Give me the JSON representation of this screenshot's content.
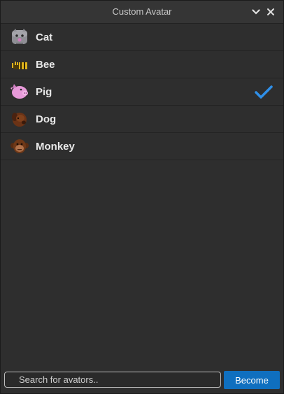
{
  "window": {
    "title": "Custom Avatar",
    "controls": {
      "collapse_icon": "chevron-down-icon",
      "close_icon": "close-icon"
    }
  },
  "avatars": [
    {
      "label": "Cat",
      "icon": "cat-avatar-icon",
      "selected": false
    },
    {
      "label": "Bee",
      "icon": "bee-avatar-icon",
      "selected": false
    },
    {
      "label": "Pig",
      "icon": "pig-avatar-icon",
      "selected": true
    },
    {
      "label": "Dog",
      "icon": "dog-avatar-icon",
      "selected": false
    },
    {
      "label": "Monkey",
      "icon": "monkey-avatar-icon",
      "selected": false
    }
  ],
  "search": {
    "placeholder": "Search for avators..",
    "value": ""
  },
  "actions": {
    "become_label": "Become"
  },
  "colors": {
    "accent": "#0f6fbf",
    "check": "#2f8fe8",
    "background": "#2e2e2e"
  }
}
